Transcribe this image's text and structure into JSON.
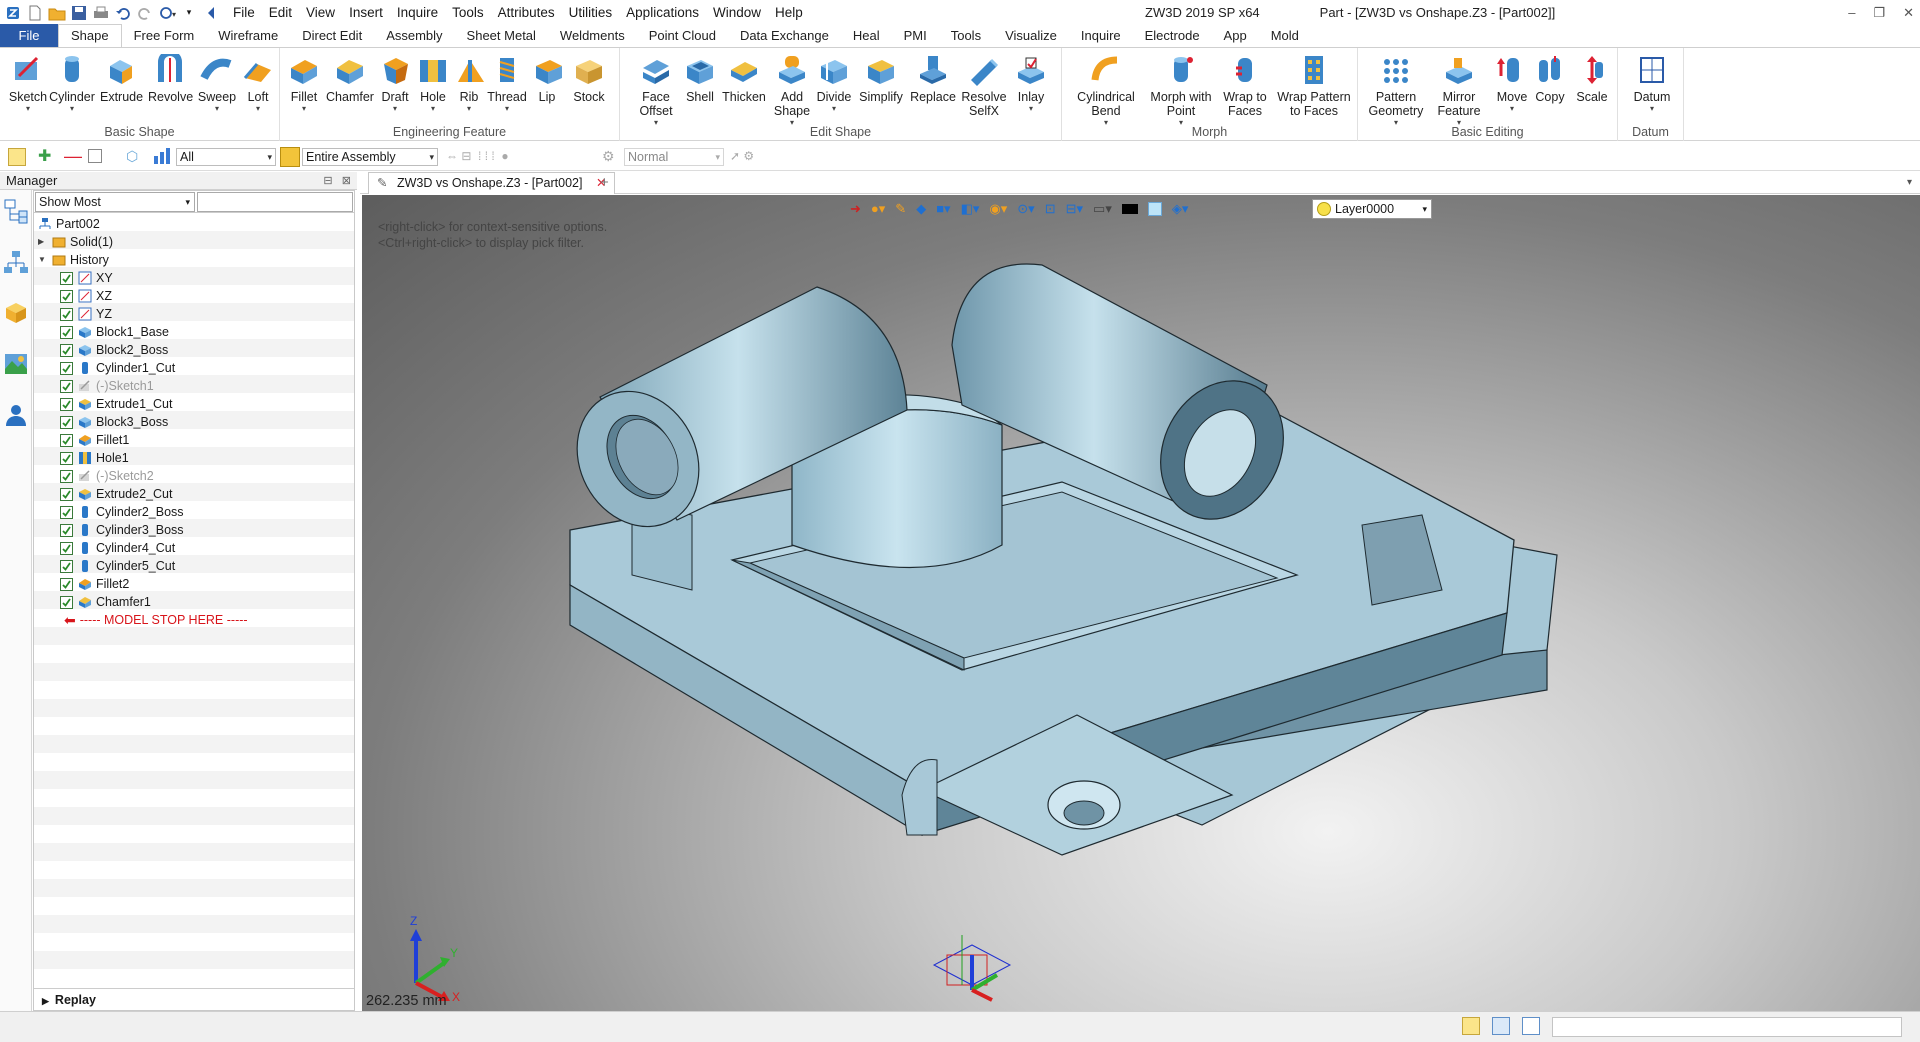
{
  "titlebar": {
    "menu": [
      "File",
      "Edit",
      "View",
      "Insert",
      "Inquire",
      "Tools",
      "Attributes",
      "Utilities",
      "Applications",
      "Window",
      "Help"
    ],
    "app_title": "ZW3D 2019 SP x64",
    "doc_title": "Part - [ZW3D vs Onshape.Z3 - [Part002]]"
  },
  "ribbon_tabs": {
    "file": "File",
    "tabs": [
      "Shape",
      "Free Form",
      "Wireframe",
      "Direct Edit",
      "Assembly",
      "Sheet Metal",
      "Weldments",
      "Point Cloud",
      "Data Exchange",
      "Heal",
      "PMI",
      "Tools",
      "Visualize",
      "Inquire",
      "Electrode",
      "App",
      "Mold"
    ],
    "active": "Shape"
  },
  "ribbon": {
    "groups": {
      "basic_shape": "Basic Shape",
      "engineering_feature": "Engineering Feature",
      "edit_shape": "Edit Shape",
      "morph": "Morph",
      "basic_editing": "Basic Editing",
      "datum": "Datum"
    },
    "buttons": {
      "sketch": "Sketch",
      "cylinder": "Cylinder",
      "extrude": "Extrude",
      "revolve": "Revolve",
      "sweep": "Sweep",
      "loft": "Loft",
      "fillet": "Fillet",
      "chamfer": "Chamfer",
      "draft": "Draft",
      "hole": "Hole",
      "rib": "Rib",
      "thread": "Thread",
      "lip": "Lip",
      "stock": "Stock",
      "face_offset": "Face Offset",
      "shell": "Shell",
      "thicken": "Thicken",
      "add_shape": "Add Shape",
      "divide": "Divide",
      "simplify": "Simplify",
      "replace": "Replace",
      "resolve_selfx": "Resolve SelfX",
      "inlay": "Inlay",
      "cylindrical_bend": "Cylindrical Bend",
      "morph_with_point": "Morph with Point",
      "wrap_to_faces": "Wrap to Faces",
      "wrap_pattern": "Wrap Pattern to Faces",
      "pattern_geometry": "Pattern Geometry",
      "mirror_feature": "Mirror Feature",
      "move": "Move",
      "copy": "Copy",
      "scale": "Scale",
      "datum": "Datum"
    }
  },
  "toolbar2": {
    "filter": "All",
    "assembly": "Entire Assembly",
    "render_mode": "Normal"
  },
  "manager": {
    "title": "Manager",
    "show": "Show Most",
    "root": "Part002",
    "tree": [
      {
        "label": "Solid(1)",
        "icon": "folder-icon",
        "level": 1,
        "checked": false,
        "muted": false,
        "expand": "collapsed"
      },
      {
        "label": "History",
        "icon": "folder-icon",
        "level": 1,
        "checked": false,
        "muted": false,
        "expand": "expanded"
      },
      {
        "label": "XY",
        "icon": "plane-icon",
        "level": 2,
        "checked": true,
        "muted": false
      },
      {
        "label": "XZ",
        "icon": "plane-icon",
        "level": 2,
        "checked": true,
        "muted": false
      },
      {
        "label": "YZ",
        "icon": "plane-icon",
        "level": 2,
        "checked": true,
        "muted": false
      },
      {
        "label": "Block1_Base",
        "icon": "block-icon",
        "level": 2,
        "checked": true,
        "muted": false
      },
      {
        "label": "Block2_Boss",
        "icon": "block-icon",
        "level": 2,
        "checked": true,
        "muted": false
      },
      {
        "label": "Cylinder1_Cut",
        "icon": "cylinder-icon",
        "level": 2,
        "checked": true,
        "muted": false
      },
      {
        "label": "(-)Sketch1",
        "icon": "sketch-icon",
        "level": 2,
        "checked": true,
        "muted": true
      },
      {
        "label": "Extrude1_Cut",
        "icon": "extrude-icon",
        "level": 2,
        "checked": true,
        "muted": false
      },
      {
        "label": "Block3_Boss",
        "icon": "block-icon",
        "level": 2,
        "checked": true,
        "muted": false
      },
      {
        "label": "Fillet1",
        "icon": "fillet-icon",
        "level": 2,
        "checked": true,
        "muted": false
      },
      {
        "label": "Hole1",
        "icon": "hole-icon",
        "level": 2,
        "checked": true,
        "muted": false
      },
      {
        "label": "(-)Sketch2",
        "icon": "sketch-icon",
        "level": 2,
        "checked": true,
        "muted": true
      },
      {
        "label": "Extrude2_Cut",
        "icon": "extrude-icon",
        "level": 2,
        "checked": true,
        "muted": false
      },
      {
        "label": "Cylinder2_Boss",
        "icon": "cylinder-icon",
        "level": 2,
        "checked": true,
        "muted": false
      },
      {
        "label": "Cylinder3_Boss",
        "icon": "cylinder-icon",
        "level": 2,
        "checked": true,
        "muted": false
      },
      {
        "label": "Cylinder4_Cut",
        "icon": "cylinder-icon",
        "level": 2,
        "checked": true,
        "muted": false
      },
      {
        "label": "Cylinder5_Cut",
        "icon": "cylinder-icon",
        "level": 2,
        "checked": true,
        "muted": false
      },
      {
        "label": "Fillet2",
        "icon": "fillet-icon",
        "level": 2,
        "checked": true,
        "muted": false
      },
      {
        "label": "Chamfer1",
        "icon": "chamfer-icon",
        "level": 2,
        "checked": true,
        "muted": false
      }
    ],
    "model_stop": "----- MODEL STOP HERE -----",
    "replay": "Replay"
  },
  "doc_tab": "ZW3D vs Onshape.Z3 - [Part002]",
  "viewport": {
    "hint_line1": "<right-click> for context-sensitive options.",
    "hint_line2": "<Ctrl+right-click> to display pick filter.",
    "layer": "Layer0000",
    "measure": "262.235 mm",
    "axis_x": "X",
    "axis_y": "Y",
    "axis_z": "Z"
  },
  "colors": {
    "model": "#a9c9d8",
    "accent": "#2a5aa8",
    "stop": "#d8151b"
  }
}
